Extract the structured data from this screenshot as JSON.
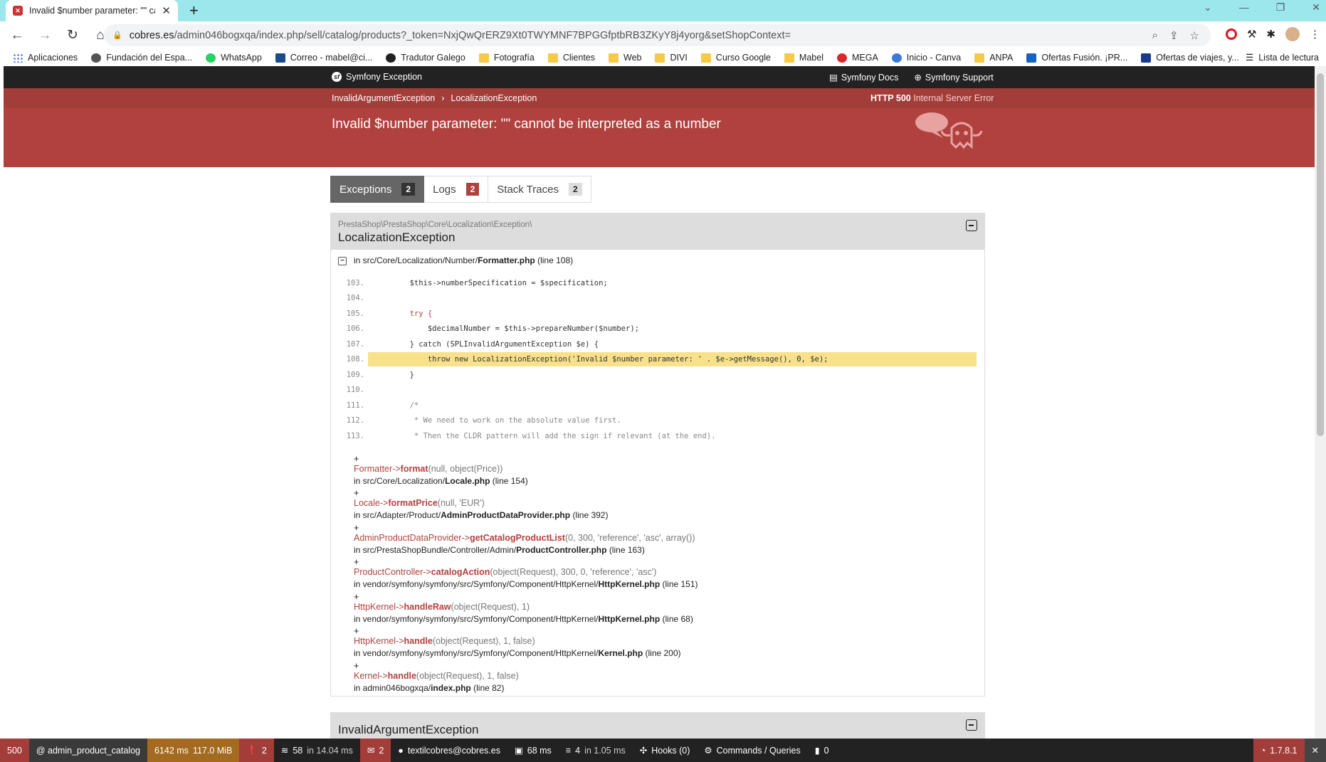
{
  "browser": {
    "tab_title": "Invalid $number parameter: \"\" ca",
    "url_host": "cobres.es",
    "url_path": "/admin046bogxqa/index.php/sell/catalog/products?_token=NxjQwQrERZ9Xt0TWYMNF7BPGGfptbRB3ZKyY8j4yorg&setShopContext=",
    "bookmarks": [
      "Aplicaciones",
      "Fundación del Espa...",
      "WhatsApp",
      "Correo - mabel@ci...",
      "Tradutor Galego",
      "Fotografía",
      "Clientes",
      "Web",
      "DIVI",
      "Curso Google",
      "Mabel",
      "MEGA",
      "Inicio - Canva",
      "ANPA",
      "Ofertas Fusión. ¡PR...",
      "Ofertas de viajes, y..."
    ],
    "reading_list": "Lista de lectura"
  },
  "symfony": {
    "brand": "Symfony Exception",
    "docs": "Symfony Docs",
    "support": "Symfony Support",
    "crumb1": "InvalidArgumentException",
    "crumb_sep": "›",
    "crumb2": "LocalizationException",
    "status_code": "HTTP 500",
    "status_text": "Internal Server Error",
    "message": "Invalid $number parameter: \"\" cannot be interpreted as a number",
    "tabs": [
      {
        "label": "Exceptions",
        "count": "2"
      },
      {
        "label": "Logs",
        "count": "2"
      },
      {
        "label": "Stack Traces",
        "count": "2"
      }
    ],
    "exception": {
      "namespace": "PrestaShop\\PrestaShop\\Core\\Localization\\Exception\\",
      "name": "LocalizationException",
      "in_text": "in src/Core/Localization/Number/",
      "in_file": "Formatter.php",
      "in_line": "(line 108)"
    },
    "code": [
      {
        "n": "103.",
        "src": "        $this->numberSpecification = $specification;"
      },
      {
        "n": "104.",
        "src": ""
      },
      {
        "n": "105.",
        "src": "        try {"
      },
      {
        "n": "106.",
        "src": "            $decimalNumber = $this->prepareNumber($number);"
      },
      {
        "n": "107.",
        "src": "        } catch (SPLInvalidArgumentException $e) {"
      },
      {
        "n": "108.",
        "src": "            throw new LocalizationException('Invalid $number parameter: ' . $e->getMessage(), 0, $e);"
      },
      {
        "n": "109.",
        "src": "        }"
      },
      {
        "n": "110.",
        "src": ""
      },
      {
        "n": "111.",
        "src": "        /*"
      },
      {
        "n": "112.",
        "src": "         * We need to work on the absolute value first."
      },
      {
        "n": "113.",
        "src": "         * Then the CLDR pattern will add the sign if relevant (at the end)."
      }
    ],
    "frames": [
      {
        "cls": "Formatter",
        "fn": "format",
        "args": "(null, object(Price))",
        "path": "in src/Core/Localization/",
        "file": "Locale.php",
        "line": "(line 154)"
      },
      {
        "cls": "Locale",
        "fn": "formatPrice",
        "args": "(null, 'EUR')",
        "path": "in src/Adapter/Product/",
        "file": "AdminProductDataProvider.php",
        "line": "(line 392)"
      },
      {
        "cls": "AdminProductDataProvider",
        "fn": "getCatalogProductList",
        "args": "(0, 300, 'reference', 'asc', array())",
        "path": "in src/PrestaShopBundle/Controller/Admin/",
        "file": "ProductController.php",
        "line": "(line 163)"
      },
      {
        "cls": "ProductController",
        "fn": "catalogAction",
        "args": "(object(Request), 300, 0, 'reference', 'asc')",
        "path": "in vendor/symfony/symfony/src/Symfony/Component/HttpKernel/",
        "file": "HttpKernel.php",
        "line": "(line 151)"
      },
      {
        "cls": "HttpKernel",
        "fn": "handleRaw",
        "args": "(object(Request), 1)",
        "path": "in vendor/symfony/symfony/src/Symfony/Component/HttpKernel/",
        "file": "HttpKernel.php",
        "line": "(line 68)"
      },
      {
        "cls": "HttpKernel",
        "fn": "handle",
        "args": "(object(Request), 1, false)",
        "path": "in vendor/symfony/symfony/src/Symfony/Component/HttpKernel/",
        "file": "Kernel.php",
        "line": "(line 200)"
      },
      {
        "cls": "Kernel",
        "fn": "handle",
        "args": "(object(Request), 1, false)",
        "path": "in admin046bogxqa/",
        "file": "index.php",
        "line": "(line 82)"
      }
    ],
    "exception2_name": "InvalidArgumentException"
  },
  "debugbar": {
    "status": "500",
    "route": "@ admin_product_catalog",
    "time": "6142 ms",
    "memory": "117.0 MiB",
    "errors": "2",
    "queries": "58",
    "queries_time": "in 14.04 ms",
    "logs": "2",
    "user": "textilcobres@cobres.es",
    "render_time": "68 ms",
    "cache": "4",
    "cache_time": "in 1.05 ms",
    "hooks": "Hooks (0)",
    "commands": "Commands / Queries",
    "count": "0",
    "version": "1.7.8.1"
  },
  "colors": {
    "accent": "#b0413e",
    "highlight": "#f8e18b",
    "tabstrip": "#9be7eb"
  }
}
